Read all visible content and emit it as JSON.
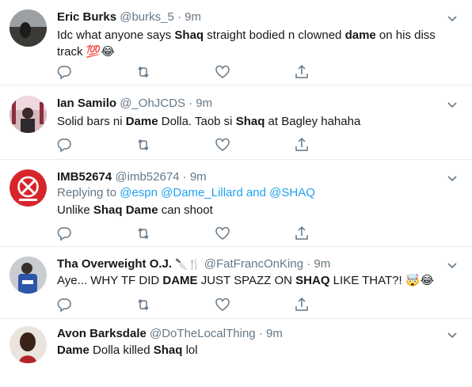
{
  "tweets": [
    {
      "name": "Eric Burks",
      "handle": "@burks_5",
      "dot": "·",
      "time": "9m",
      "text_parts": [
        {
          "t": "Idc what anyone says ",
          "b": false
        },
        {
          "t": "Shaq",
          "b": true
        },
        {
          "t": " straight bodied n clowned ",
          "b": false
        },
        {
          "t": "dame",
          "b": true
        },
        {
          "t": " on his diss track ",
          "b": false
        },
        {
          "t": "💯😂",
          "b": false
        }
      ]
    },
    {
      "name": "Ian Samilo",
      "handle": "@_OhJCDS",
      "dot": "·",
      "time": "9m",
      "text_parts": [
        {
          "t": "Solid bars ni ",
          "b": false
        },
        {
          "t": "Dame",
          "b": true
        },
        {
          "t": " Dolla. Taob si ",
          "b": false
        },
        {
          "t": "Shaq",
          "b": true
        },
        {
          "t": " at Bagley hahaha",
          "b": false
        }
      ]
    },
    {
      "name": "IMB52674",
      "handle": "@imb52674",
      "dot": "·",
      "time": "9m",
      "replying_label": "Replying to",
      "replying_mentions": "@espn @Dame_Lillard",
      "replying_and": "and",
      "replying_last": "@SHAQ",
      "text_parts": [
        {
          "t": "Unlike ",
          "b": false
        },
        {
          "t": "Shaq Dame",
          "b": true
        },
        {
          "t": " can shoot",
          "b": false
        }
      ]
    },
    {
      "name": "Tha Overweight O.J.",
      "name_emoji": "🔪🍴",
      "handle": "@FatFrancOnKing",
      "dot": "·",
      "time": "9m",
      "text_parts": [
        {
          "t": "Aye... WHY TF DID ",
          "b": false
        },
        {
          "t": "DAME",
          "b": true
        },
        {
          "t": " JUST SPAZZ ON ",
          "b": false
        },
        {
          "t": "SHAQ",
          "b": true
        },
        {
          "t": " LIKE THAT?! ",
          "b": false
        },
        {
          "t": "🤯😂",
          "b": false
        }
      ]
    },
    {
      "name": "Avon Barksdale",
      "handle": "@DoTheLocalThing",
      "dot": "·",
      "time": "9m",
      "text_parts": [
        {
          "t": "Dame",
          "b": true
        },
        {
          "t": " Dolla killed ",
          "b": false
        },
        {
          "t": "Shaq",
          "b": true
        },
        {
          "t": " lol",
          "b": false
        }
      ]
    }
  ],
  "icons": {
    "reply": "reply-icon",
    "retweet": "retweet-icon",
    "like": "heart-icon",
    "share": "share-icon",
    "caret": "chevron-down-icon"
  },
  "colors": {
    "text": "#14171a",
    "muted": "#657786",
    "link": "#1da1f2",
    "divider": "#e6ecf0"
  }
}
